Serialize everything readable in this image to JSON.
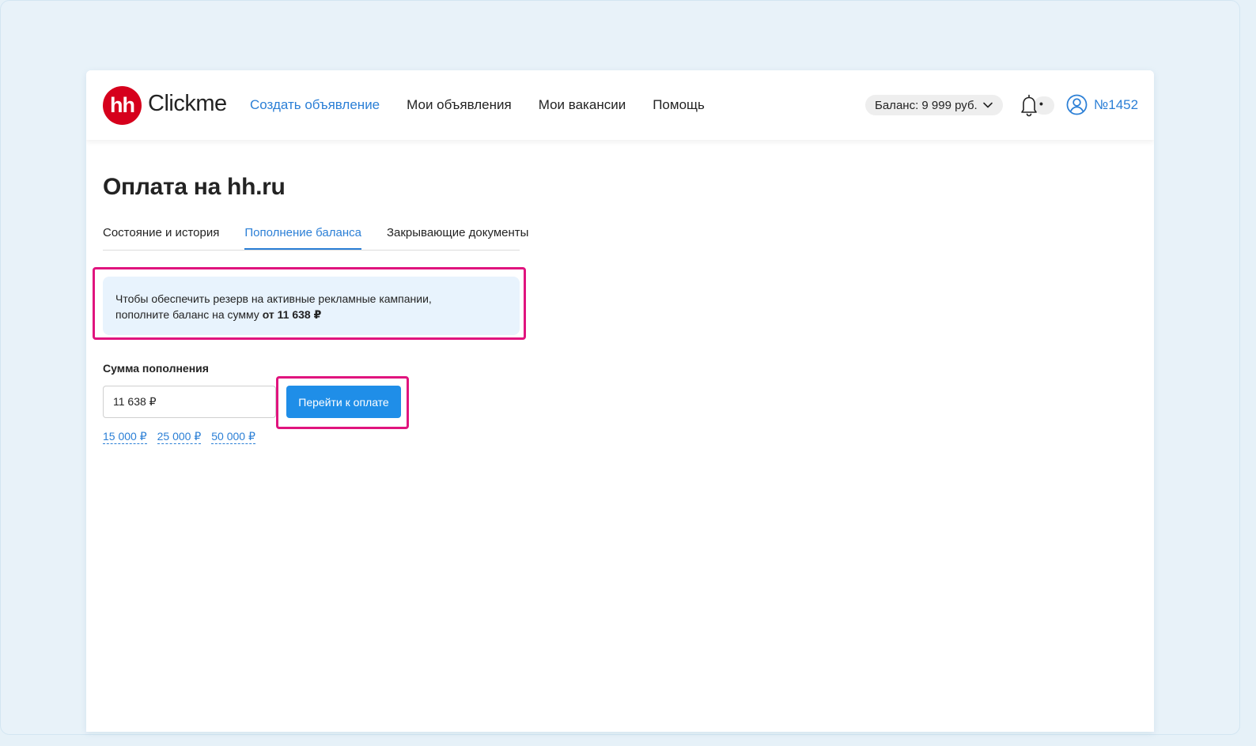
{
  "header": {
    "logo_mark": "hh",
    "logo_text": "Clickme",
    "nav": [
      {
        "label": "Создать объявление"
      },
      {
        "label": "Мои объявления"
      },
      {
        "label": "Мои вакансии"
      },
      {
        "label": "Помощь"
      }
    ],
    "balance_label": "Баланс: 9 999 руб.",
    "notification_marker": "•",
    "account_label": "№1452"
  },
  "page": {
    "title": "Оплата на hh.ru",
    "tabs": [
      {
        "label": "Состояние и история"
      },
      {
        "label": "Пополнение баланса"
      },
      {
        "label": "Закрывающие документы"
      }
    ],
    "active_tab": "Пополнение баланса",
    "info_text_line1": "Чтобы обеспечить резерв на активные рекламные кампании,",
    "info_text_line2": "пополните баланс на сумму",
    "info_text_amount": "от 11 638 ₽",
    "amount_label": "Сумма пополнения",
    "amount_value": "11 638 ₽",
    "pay_button_label": "Перейти к оплате",
    "presets": [
      "15 000 ₽",
      "25 000 ₽",
      "50 000 ₽"
    ]
  },
  "colors": {
    "brand_red": "#d6001c",
    "link_blue": "#2b7fd6",
    "button_blue": "#1f8ee8",
    "highlight_magenta": "#e0147e",
    "info_bg": "#e8f3fd"
  },
  "icons": [
    "bell-icon",
    "user-icon",
    "chevron-down-icon"
  ]
}
